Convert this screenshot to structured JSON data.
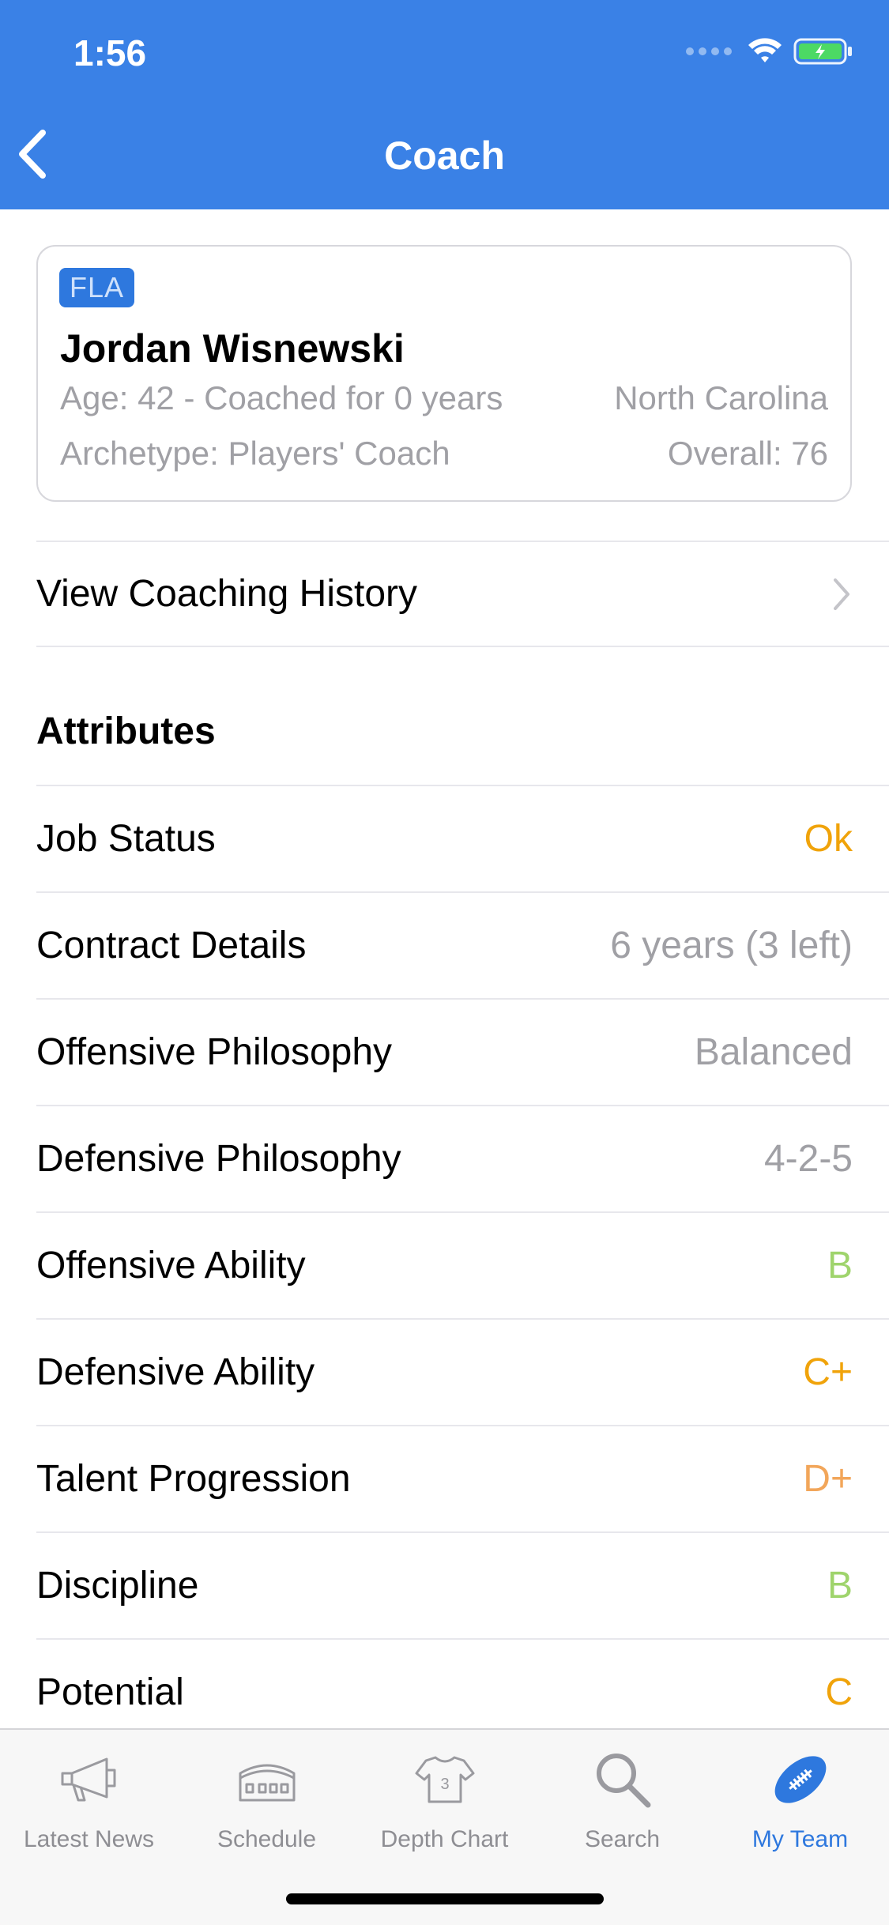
{
  "status_bar": {
    "time": "1:56"
  },
  "nav": {
    "title": "Coach",
    "back_icon": "chevron-left-icon"
  },
  "coach": {
    "team": "FLA",
    "name": "Jordan Wisnewski",
    "age_line": "Age: 42 - Coached for 0 years",
    "location": "North Carolina",
    "archetype": "Archetype: Players' Coach",
    "overall": "Overall: 76"
  },
  "history_link": {
    "label": "View Coaching History"
  },
  "attributes": {
    "title": "Attributes",
    "rows": [
      {
        "label": "Job Status",
        "value": "Ok",
        "color": "#f0a30a"
      },
      {
        "label": "Contract Details",
        "value": "6 years (3 left)",
        "color": "#a0a0a5"
      },
      {
        "label": "Offensive Philosophy",
        "value": "Balanced",
        "color": "#a0a0a5"
      },
      {
        "label": "Defensive Philosophy",
        "value": "4-2-5",
        "color": "#a0a0a5"
      },
      {
        "label": "Offensive Ability",
        "value": "B",
        "color": "#9fd46c"
      },
      {
        "label": "Defensive Ability",
        "value": "C+",
        "color": "#f0a30a"
      },
      {
        "label": "Talent Progression",
        "value": "D+",
        "color": "#f2a65a"
      },
      {
        "label": "Discipline",
        "value": "B",
        "color": "#9fd46c"
      },
      {
        "label": "Potential",
        "value": "C",
        "color": "#f0a30a"
      }
    ]
  },
  "tabs": [
    {
      "label": "Latest News",
      "icon": "megaphone-icon",
      "active": false
    },
    {
      "label": "Schedule",
      "icon": "stadium-icon",
      "active": false
    },
    {
      "label": "Depth Chart",
      "icon": "jersey-icon",
      "active": false
    },
    {
      "label": "Search",
      "icon": "search-icon",
      "active": false
    },
    {
      "label": "My Team",
      "icon": "football-icon",
      "active": true
    }
  ],
  "colors": {
    "header": "#3a81e6",
    "accent": "#2e78de"
  }
}
